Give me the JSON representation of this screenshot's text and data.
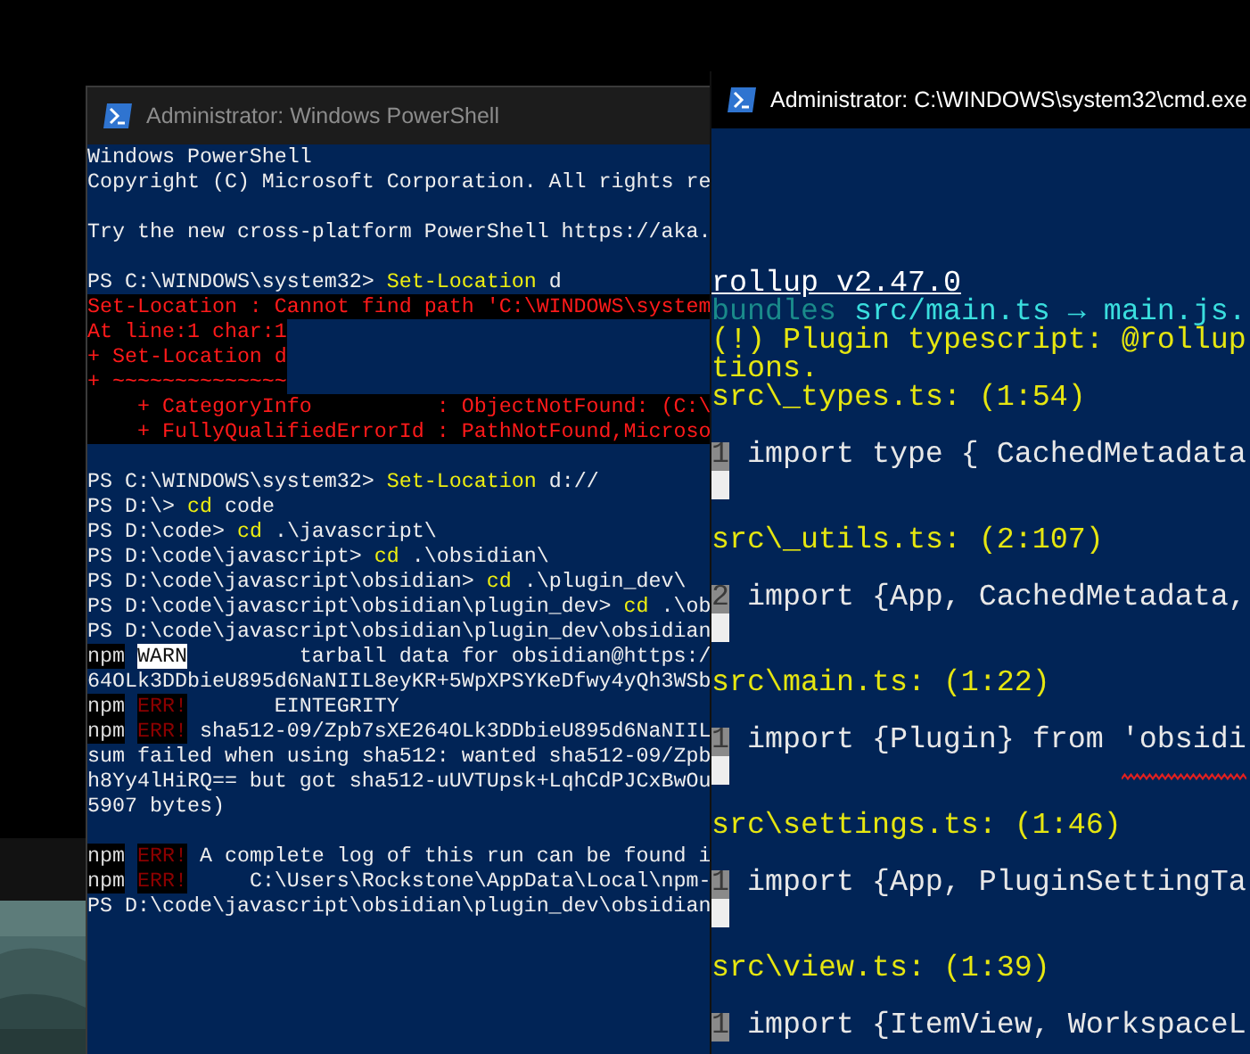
{
  "powershell_window": {
    "title": "Administrator: Windows PowerShell",
    "active": false,
    "lines": [
      {
        "kind": "text",
        "segments": [
          {
            "kind": "plain",
            "text": "Windows PowerShell"
          }
        ]
      },
      {
        "kind": "text",
        "segments": [
          {
            "kind": "plain",
            "text": "Copyright (C) Microsoft Corporation. All rights re"
          }
        ]
      },
      {
        "kind": "blank"
      },
      {
        "kind": "text",
        "segments": [
          {
            "kind": "plain",
            "text": "Try the new cross-platform PowerShell https://aka."
          }
        ]
      },
      {
        "kind": "blank"
      },
      {
        "kind": "text",
        "segments": [
          {
            "kind": "plain",
            "text": "PS C:\\WINDOWS\\system32> "
          },
          {
            "kind": "command",
            "text": "Set-Location"
          },
          {
            "kind": "plain",
            "text": " d"
          }
        ]
      },
      {
        "kind": "error",
        "segments": [
          {
            "kind": "error",
            "text": "Set-Location : Cannot find path 'C:\\WINDOWS\\system"
          }
        ]
      },
      {
        "kind": "text",
        "segments": [
          {
            "kind": "error",
            "text": "At line:1 char:1"
          }
        ]
      },
      {
        "kind": "text",
        "segments": [
          {
            "kind": "error",
            "text": "+ Set-Location d"
          }
        ]
      },
      {
        "kind": "text",
        "segments": [
          {
            "kind": "error",
            "text": "+ ~~~~~~~~~~~~~~"
          }
        ]
      },
      {
        "kind": "error",
        "segments": [
          {
            "kind": "error",
            "text": "    + CategoryInfo          : ObjectNotFound: (C:\\"
          }
        ]
      },
      {
        "kind": "error",
        "segments": [
          {
            "kind": "error",
            "text": "    + FullyQualifiedErrorId : PathNotFound,Microso"
          }
        ]
      },
      {
        "kind": "blank"
      },
      {
        "kind": "text",
        "segments": [
          {
            "kind": "plain",
            "text": "PS C:\\WINDOWS\\system32> "
          },
          {
            "kind": "command",
            "text": "Set-Location"
          },
          {
            "kind": "plain",
            "text": " d://"
          }
        ]
      },
      {
        "kind": "text",
        "segments": [
          {
            "kind": "plain",
            "text": "PS D:\\> "
          },
          {
            "kind": "command",
            "text": "cd"
          },
          {
            "kind": "plain",
            "text": " code"
          }
        ]
      },
      {
        "kind": "text",
        "segments": [
          {
            "kind": "plain",
            "text": "PS D:\\code> "
          },
          {
            "kind": "command",
            "text": "cd"
          },
          {
            "kind": "plain",
            "text": " .\\javascript\\"
          }
        ]
      },
      {
        "kind": "text",
        "segments": [
          {
            "kind": "plain",
            "text": "PS D:\\code\\javascript> "
          },
          {
            "kind": "command",
            "text": "cd"
          },
          {
            "kind": "plain",
            "text": " .\\obsidian\\"
          }
        ]
      },
      {
        "kind": "text",
        "segments": [
          {
            "kind": "plain",
            "text": "PS D:\\code\\javascript\\obsidian> "
          },
          {
            "kind": "command",
            "text": "cd"
          },
          {
            "kind": "plain",
            "text": " .\\plugin_dev\\"
          }
        ]
      },
      {
        "kind": "text",
        "segments": [
          {
            "kind": "plain",
            "text": "PS D:\\code\\javascript\\obsidian\\plugin_dev> "
          },
          {
            "kind": "command",
            "text": "cd"
          },
          {
            "kind": "plain",
            "text": " .\\ob"
          }
        ]
      },
      {
        "kind": "text",
        "segments": [
          {
            "kind": "plain",
            "text": "PS D:\\code\\javascript\\obsidian\\plugin_dev\\obsidian"
          }
        ]
      },
      {
        "kind": "text",
        "segments": [
          {
            "kind": "npm",
            "text": "npm"
          },
          {
            "kind": "warn",
            "text": "WARN"
          },
          {
            "kind": "plain",
            "text": "         tarball data for obsidian@https:/"
          }
        ]
      },
      {
        "kind": "text",
        "segments": [
          {
            "kind": "plain",
            "text": "64OLk3DDbieU895d6NaNIIL8eyKR+5WpXPSYKeDfwy4yQh3WSb"
          }
        ]
      },
      {
        "kind": "text",
        "segments": [
          {
            "kind": "npm",
            "text": "npm"
          },
          {
            "kind": "errtag",
            "text": "ERR!"
          },
          {
            "kind": "plain",
            "text": "       EINTEGRITY"
          }
        ]
      },
      {
        "kind": "text",
        "segments": [
          {
            "kind": "npm",
            "text": "npm"
          },
          {
            "kind": "errtag",
            "text": "ERR!"
          },
          {
            "kind": "plain",
            "text": " sha512-09/Zpb7sXE264OLk3DDbieU895d6NaNIIL"
          }
        ]
      },
      {
        "kind": "text",
        "segments": [
          {
            "kind": "plain",
            "text": "sum failed when using sha512: wanted sha512-09/Zpb"
          }
        ]
      },
      {
        "kind": "text",
        "segments": [
          {
            "kind": "plain",
            "text": "h8Yy4lHiRQ== but got sha512-uUVTUpsk+LqhCdPJCxBwOu"
          }
        ]
      },
      {
        "kind": "text",
        "segments": [
          {
            "kind": "plain",
            "text": "5907 bytes)"
          }
        ]
      },
      {
        "kind": "blank"
      },
      {
        "kind": "text",
        "segments": [
          {
            "kind": "npm",
            "text": "npm"
          },
          {
            "kind": "errtag",
            "text": "ERR!"
          },
          {
            "kind": "plain",
            "text": " A complete log of this run can be found i"
          }
        ]
      },
      {
        "kind": "text",
        "segments": [
          {
            "kind": "npm",
            "text": "npm"
          },
          {
            "kind": "errtag",
            "text": "ERR!"
          },
          {
            "kind": "plain",
            "text": "     C:\\Users\\Rockstone\\AppData\\Local\\npm-"
          }
        ]
      },
      {
        "kind": "text",
        "segments": [
          {
            "kind": "plain",
            "text": "PS D:\\code\\javascript\\obsidian\\plugin_dev\\obsidian"
          }
        ]
      }
    ]
  },
  "cmd_window": {
    "title": "Administrator:  C:\\WINDOWS\\system32\\cmd.exe",
    "active": true,
    "lines": [
      {
        "kind": "text",
        "segments": [
          {
            "kind": "heading",
            "text": "rollup v2.47.0"
          }
        ]
      },
      {
        "kind": "text",
        "segments": [
          {
            "kind": "dim",
            "text": "bundles "
          },
          {
            "kind": "cyan",
            "text": "src/main.ts → main.js."
          }
        ]
      },
      {
        "kind": "text",
        "segments": [
          {
            "kind": "yellow",
            "text": "(!) Plugin typescript: @rollup"
          }
        ]
      },
      {
        "kind": "text",
        "segments": [
          {
            "kind": "yellow",
            "text": "tions."
          }
        ]
      },
      {
        "kind": "text",
        "segments": [
          {
            "kind": "yellow",
            "text": "src\\_types.ts: (1:54)"
          }
        ]
      },
      {
        "kind": "blank"
      },
      {
        "kind": "code",
        "number": "1",
        "segments": [
          {
            "kind": "code",
            "text": " import type { CachedMetadata"
          }
        ]
      },
      {
        "kind": "gutter"
      },
      {
        "kind": "blank"
      },
      {
        "kind": "text",
        "segments": [
          {
            "kind": "yellow",
            "text": "src\\_utils.ts: (2:107)"
          }
        ]
      },
      {
        "kind": "blank"
      },
      {
        "kind": "code",
        "number": "2",
        "segments": [
          {
            "kind": "code",
            "text": " import {App, CachedMetadata,"
          }
        ]
      },
      {
        "kind": "gutter"
      },
      {
        "kind": "blank"
      },
      {
        "kind": "text",
        "segments": [
          {
            "kind": "yellow",
            "text": "src\\main.ts: (1:22)"
          }
        ]
      },
      {
        "kind": "blank"
      },
      {
        "kind": "code",
        "number": "1",
        "segments": [
          {
            "kind": "code",
            "text": " import {Plugin} from "
          },
          {
            "kind": "code",
            "text": "'obsidi",
            "squiggle": true
          }
        ]
      },
      {
        "kind": "gutter"
      },
      {
        "kind": "blank"
      },
      {
        "kind": "text",
        "segments": [
          {
            "kind": "yellow",
            "text": "src\\settings.ts: (1:46)"
          }
        ]
      },
      {
        "kind": "blank"
      },
      {
        "kind": "code",
        "number": "1",
        "segments": [
          {
            "kind": "code",
            "text": " import {App, PluginSettingTa"
          }
        ]
      },
      {
        "kind": "gutter"
      },
      {
        "kind": "blank"
      },
      {
        "kind": "text",
        "segments": [
          {
            "kind": "yellow",
            "text": "src\\view.ts: (1:39)"
          }
        ]
      },
      {
        "kind": "blank"
      },
      {
        "kind": "code",
        "number": "1",
        "segments": [
          {
            "kind": "code",
            "text": " import {ItemView, WorkspaceL"
          }
        ]
      }
    ]
  }
}
